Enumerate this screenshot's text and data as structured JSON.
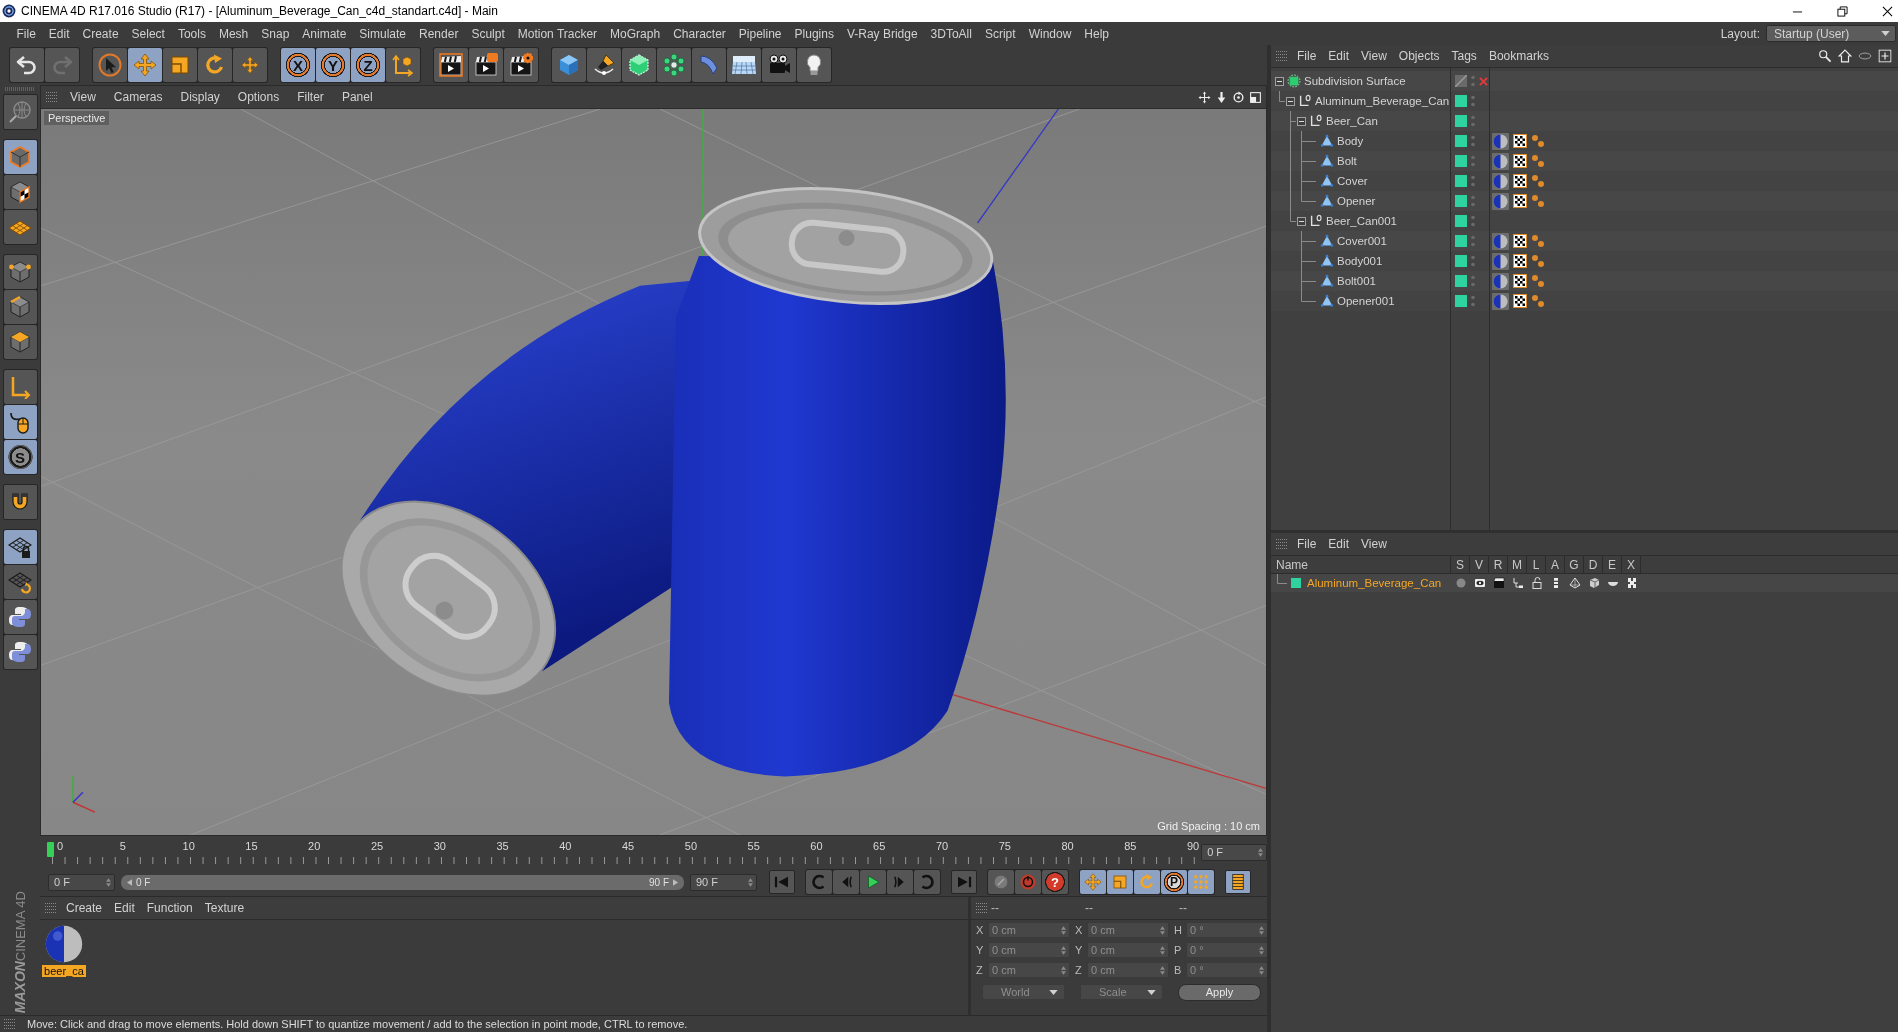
{
  "window": {
    "title": "CINEMA 4D R17.016 Studio (R17) - [Aluminum_Beverage_Can_c4d_standart.c4d] - Main"
  },
  "menu_bar": {
    "items": [
      "File",
      "Edit",
      "Create",
      "Select",
      "Tools",
      "Mesh",
      "Snap",
      "Animate",
      "Simulate",
      "Render",
      "Sculpt",
      "Motion Tracker",
      "MoGraph",
      "Character",
      "Pipeline",
      "Plugins",
      "V-Ray Bridge",
      "3DToAll",
      "Script",
      "Window",
      "Help"
    ],
    "layout_label": "Layout:",
    "layout_value": "Startup (User)"
  },
  "toolbar": {
    "history": [
      {
        "disabled": false
      },
      {
        "disabled": true
      }
    ],
    "tools": [
      {
        "selected": false
      },
      {
        "selected": true
      },
      {
        "selected": false
      },
      {
        "selected": false
      },
      {
        "selected": false
      }
    ],
    "axes": [
      {
        "label": "X",
        "selected": true
      },
      {
        "label": "Y",
        "selected": true
      },
      {
        "label": "Z",
        "selected": true
      }
    ],
    "coordinate_system": {
      "selected": false
    }
  },
  "left_toolbar": {
    "buttons": [
      {
        "selected": false
      },
      {
        "selected": true
      },
      {
        "selected": false
      },
      {
        "selected": false
      },
      {
        "selected": false
      },
      {
        "selected": false
      },
      {
        "selected": false
      },
      {
        "selected": false
      },
      {
        "selected": true
      },
      {
        "label": "S",
        "selected": true
      },
      {
        "selected": false
      },
      {
        "selected": true
      },
      {
        "selected": false
      },
      {
        "selected": false
      },
      {
        "selected": false
      }
    ],
    "branding": {
      "maker": "MAXON",
      "product": "CINEMA 4D"
    }
  },
  "viewport": {
    "menu": [
      "View",
      "Cameras",
      "Display",
      "Options",
      "Filter",
      "Panel"
    ],
    "camera": "Perspective",
    "grid_spacing": "Grid Spacing : 10 cm"
  },
  "timeline": {
    "labels": [
      "0",
      "5",
      "10",
      "15",
      "20",
      "25",
      "30",
      "35",
      "40",
      "45",
      "50",
      "55",
      "60",
      "65",
      "70",
      "75",
      "80",
      "85",
      "90"
    ],
    "level": 0,
    "current_frame": "0 F"
  },
  "playback": {
    "time_field": "0 F",
    "range": {
      "start": "0 F",
      "end": "90 F",
      "level": 1
    },
    "end_field": "90 F",
    "keyframe_selection": "?",
    "key_filters": [
      {
        "selected": true
      },
      {
        "selected": true
      },
      {
        "selected": true
      },
      {
        "label": "P",
        "selected": true
      },
      {
        "selected": true
      }
    ],
    "timeline_button": {
      "selected": true
    }
  },
  "materials": {
    "menu": [
      "Create",
      "Edit",
      "Function",
      "Texture"
    ],
    "items": [
      {
        "name": "beer_ca",
        "selected": true
      }
    ]
  },
  "coordinates": {
    "headers": [
      "--",
      "--",
      "--"
    ],
    "rows": [
      {
        "position_axis": "X",
        "position": "0 cm",
        "size_axis": "X",
        "size": "0 cm",
        "rotation_axis": "H",
        "rotation": "0 °"
      },
      {
        "position_axis": "Y",
        "position": "0 cm",
        "size_axis": "Y",
        "size": "0 cm",
        "rotation_axis": "P",
        "rotation": "0 °"
      },
      {
        "position_axis": "Z",
        "position": "0 cm",
        "size_axis": "Z",
        "size": "0 cm",
        "rotation_axis": "B",
        "rotation": "0 °"
      }
    ],
    "position_mode": "World",
    "size_mode": "Scale",
    "apply": "Apply"
  },
  "object_manager": {
    "menu": [
      "File",
      "Edit",
      "View",
      "Objects",
      "Tags",
      "Bookmarks"
    ],
    "tree": [
      {
        "name": "Subdivision Surface",
        "kind": "subdivision",
        "expanded": true,
        "enabled": false,
        "on_layer": false,
        "tagged": false,
        "children": [
          {
            "name": "Aluminum_Beverage_Can",
            "kind": "null",
            "expanded": true,
            "on_layer": true,
            "tagged": false,
            "children": [
              {
                "name": "Beer_Can",
                "kind": "null",
                "expanded": true,
                "on_layer": true,
                "tagged": false,
                "children": [
                  {
                    "name": "Body",
                    "kind": "polygon",
                    "on_layer": true,
                    "tagged": true
                  },
                  {
                    "name": "Bolt",
                    "kind": "polygon",
                    "on_layer": true,
                    "tagged": true
                  },
                  {
                    "name": "Cover",
                    "kind": "polygon",
                    "on_layer": true,
                    "tagged": true
                  },
                  {
                    "name": "Opener",
                    "kind": "polygon",
                    "on_layer": true,
                    "tagged": true
                  }
                ]
              },
              {
                "name": "Beer_Can001",
                "kind": "null",
                "expanded": true,
                "on_layer": true,
                "tagged": false,
                "children": [
                  {
                    "name": "Cover001",
                    "kind": "polygon",
                    "on_layer": true,
                    "tagged": true
                  },
                  {
                    "name": "Body001",
                    "kind": "polygon",
                    "on_layer": true,
                    "tagged": true
                  },
                  {
                    "name": "Bolt001",
                    "kind": "polygon",
                    "on_layer": true,
                    "tagged": true
                  },
                  {
                    "name": "Opener001",
                    "kind": "polygon",
                    "on_layer": true,
                    "tagged": true
                  }
                ]
              }
            ]
          }
        ]
      }
    ]
  },
  "layer_manager": {
    "menu": [
      "File",
      "Edit",
      "View"
    ],
    "columns": [
      "Name",
      "S",
      "V",
      "R",
      "M",
      "L",
      "A",
      "G",
      "D",
      "E",
      "X"
    ],
    "layers": [
      {
        "name": "Aluminum_Beverage_Can",
        "color": "#2ed3a0",
        "selected": true
      }
    ]
  },
  "status_bar": {
    "text": "Move: Click and drag to move elements. Hold down SHIFT to quantize movement / add to the selection in point mode, CTRL to remove."
  }
}
